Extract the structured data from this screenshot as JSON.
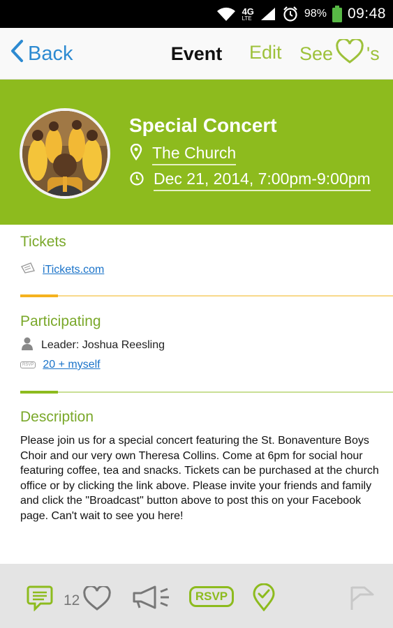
{
  "status_bar": {
    "network": "4G",
    "network_sub": "LTE",
    "battery_percent": "98%",
    "time": "09:48"
  },
  "nav": {
    "back_label": "Back",
    "title": "Event",
    "edit_label": "Edit",
    "see_label": "See",
    "see_suffix": "'s"
  },
  "event": {
    "title": "Special Concert",
    "location": "The Church",
    "datetime": "Dec 21, 2014, 7:00pm-9:00pm"
  },
  "tickets": {
    "heading": "Tickets",
    "link": "iTickets.com"
  },
  "participating": {
    "heading": "Participating",
    "leader": "Leader: Joshua Reesling",
    "rsvp_badge": "RSVP",
    "rsvp_link": "20 + myself"
  },
  "description": {
    "heading": "Description",
    "text": "Please join us for a special concert featuring the St. Bonaventure Boys Choir and our very own Theresa Collins. Come at 6pm for social hour featuring coffee, tea and snacks. Tickets can be purchased at the church office or by clicking the link above.  Please invite your friends and family and click the \"Broadcast\" button above to post this on your Facebook page. Can't wait to see you here!"
  },
  "bottom_bar": {
    "like_count": "12",
    "rsvp_label": "RSVP"
  },
  "colors": {
    "accent_green": "#8dbb1e",
    "heading_green": "#7aa82a",
    "link_blue": "#1a73c9",
    "nav_blue": "#2d8ad1",
    "divider_orange": "#f5b21f"
  },
  "icons": [
    "wifi-icon",
    "signal-icon",
    "alarm-icon",
    "battery-icon",
    "back-chevron-icon",
    "heart-icon",
    "location-pin-icon",
    "clock-icon",
    "ticket-icon",
    "person-icon",
    "rsvp-icon",
    "comment-icon",
    "megaphone-icon",
    "checkin-icon",
    "flag-icon"
  ]
}
